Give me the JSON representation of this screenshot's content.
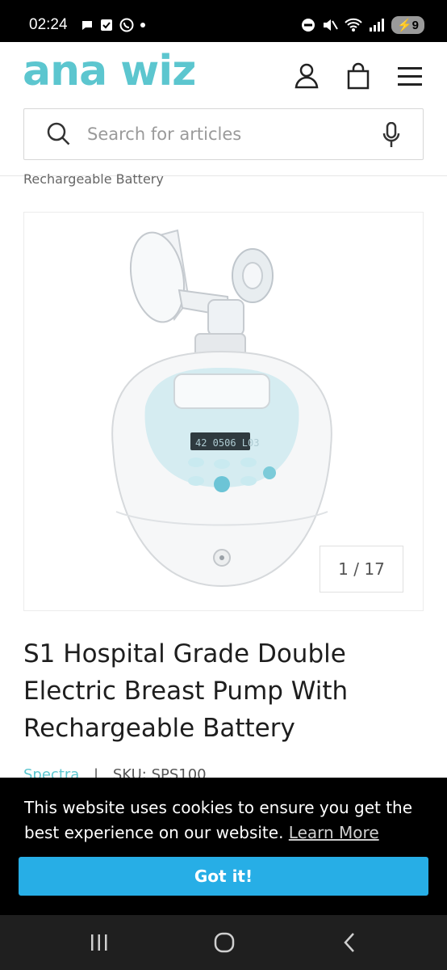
{
  "status_bar": {
    "time": "02:24",
    "battery": "9"
  },
  "header": {
    "logo_text": "ana wiz",
    "logo_color": "#5cc6cf",
    "icons": [
      "account-icon",
      "bag-icon",
      "menu-icon"
    ]
  },
  "search": {
    "placeholder": "Search for articles"
  },
  "breadcrumb_partial": "Rechargeable Battery",
  "gallery": {
    "counter": "1 / 17",
    "image_alt": "Spectra S1 breast pump"
  },
  "product": {
    "title": "S1 Hospital Grade Double Electric Breast Pump With Rechargeable Battery",
    "brand": "Spectra",
    "separator": "|",
    "sku": "SKU: SPS100"
  },
  "cookie": {
    "message": "This website uses cookies to ensure you get the best experience on our website.",
    "learn_more": "Learn More",
    "button": "Got it!",
    "button_color": "#27aee6"
  },
  "nav": {
    "icons": [
      "recent-apps-icon",
      "home-icon",
      "back-icon"
    ]
  }
}
